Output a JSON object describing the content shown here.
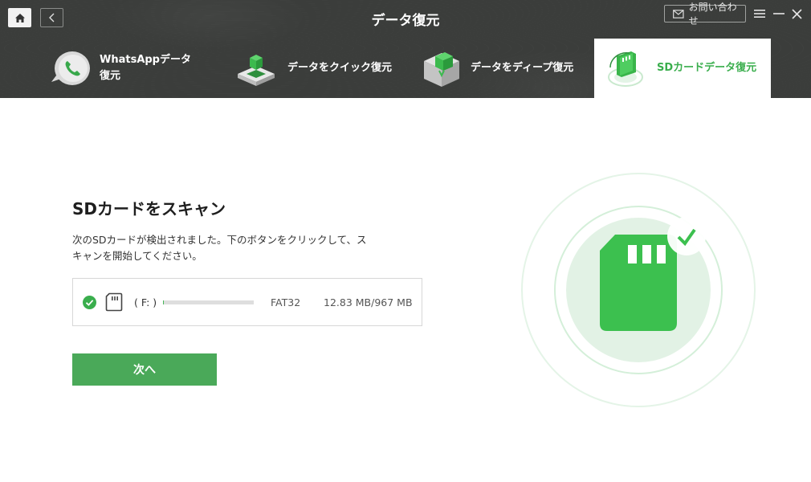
{
  "header": {
    "title": "データ復元",
    "contact_label": "お問い合わせ"
  },
  "tabs": [
    {
      "label": "WhatsAppデータ復元",
      "active": false,
      "icon": "whatsapp-phone-icon"
    },
    {
      "label": "データをクイック復元",
      "active": false,
      "icon": "quick-recover-cube-icon"
    },
    {
      "label": "データをディープ復元",
      "active": false,
      "icon": "deep-recover-box-icon"
    },
    {
      "label": "SDカードデータ復元",
      "active": true,
      "icon": "sd-card-recover-icon"
    }
  ],
  "main": {
    "title": "SDカードをスキャン",
    "description": "次のSDカードが検出されました。下のボタンをクリックして、スキャンを開始してください。",
    "drive": {
      "letter": "( F: )",
      "filesystem": "FAT32",
      "size": "12.83 MB/967 MB",
      "used_fraction": 0.013,
      "selected": true
    },
    "next_label": "次へ"
  },
  "colors": {
    "accent": "#3aae4d",
    "header_bg": "#3b3d3b",
    "button_bg": "#4aa959"
  }
}
